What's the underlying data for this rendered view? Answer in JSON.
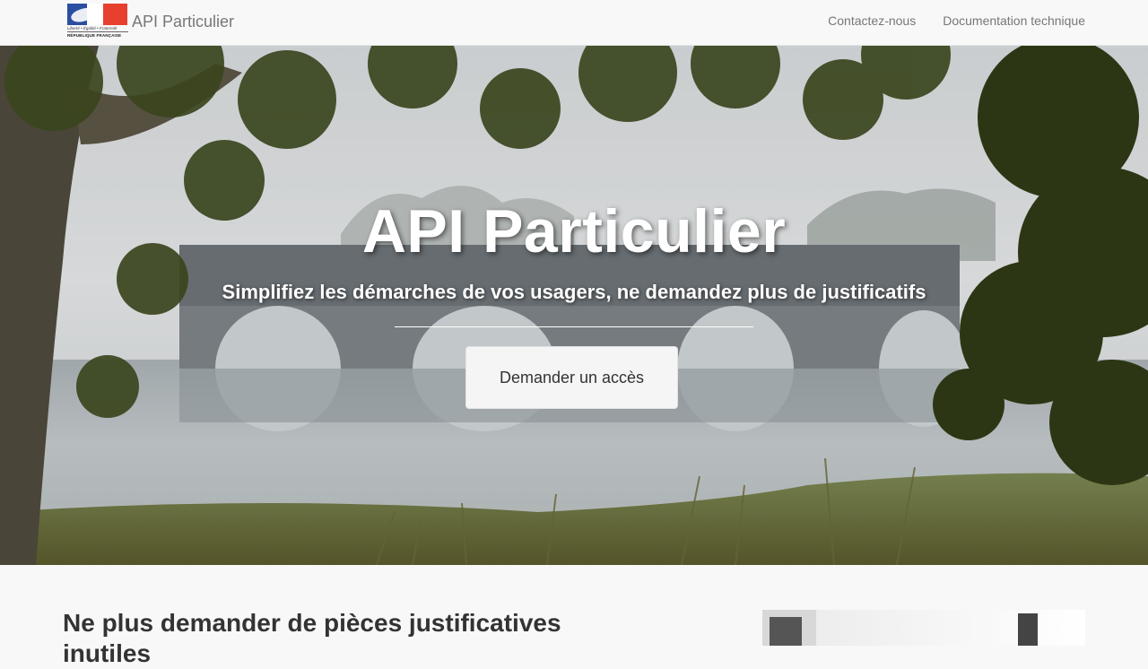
{
  "header": {
    "logo_motto": "Liberté • Égalité • Fraternité",
    "logo_republique": "RÉPUBLIQUE FRANÇAISE",
    "brand_name": "API Particulier",
    "nav": [
      {
        "label": "Contactez-nous"
      },
      {
        "label": "Documentation technique"
      }
    ]
  },
  "hero": {
    "title": "API Particulier",
    "subtitle": "Simplifiez les démarches de vos usagers, ne demandez plus de justificatifs",
    "cta_label": "Demander un accès"
  },
  "section": {
    "title": "Ne plus demander de pièces justificatives inutiles"
  },
  "colors": {
    "flag_blue": "#2b4ea0",
    "flag_red": "#e8402f",
    "navbar_bg": "#f8f8f8",
    "nav_text": "#777777"
  }
}
